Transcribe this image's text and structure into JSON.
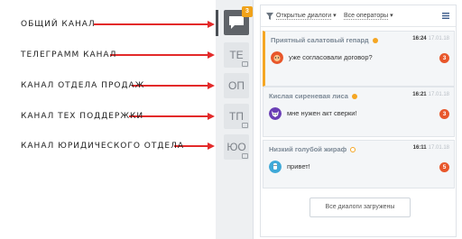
{
  "annotations": [
    {
      "label": "ОБЩИЙ КАНАЛ"
    },
    {
      "label": "ТЕЛЕГРАММ КАНАЛ"
    },
    {
      "label": "КАНАЛ ОТДЕЛА ПРОДАЖ"
    },
    {
      "label": "КАНАЛ ТЕХ ПОДДЕРЖКИ"
    },
    {
      "label": "КАНАЛ ЮРИДИЧЕСКОГО ОТДЕЛА"
    }
  ],
  "channels": {
    "general_badge": "3",
    "items": [
      {
        "label": "ТЕ"
      },
      {
        "label": "ОП"
      },
      {
        "label": "ТП"
      },
      {
        "label": "ЮО"
      }
    ]
  },
  "filters": {
    "dialogs": "Открытые диалоги",
    "operators": "Все операторы"
  },
  "dialogs": [
    {
      "name": "Приятный салатовый гепард",
      "time": "16:24",
      "date": "17.01.18",
      "message": "уже согласовали договор?",
      "count": "3",
      "avatar_color": "#e8572b"
    },
    {
      "name": "Кислая сиреневая лиса",
      "time": "16:21",
      "date": "17.01.18",
      "message": "мне нужен акт сверки!",
      "count": "3",
      "avatar_color": "#6a3fb5"
    },
    {
      "name": "Низкий голубой жираф",
      "time": "16:11",
      "date": "17.01.18",
      "message": "привет!",
      "count": "5",
      "avatar_color": "#3fa9d8"
    }
  ],
  "footer": {
    "loaded_label": "Все диалоги загружены"
  },
  "colors": {
    "accent": "#f5a623",
    "arrow": "#e32a2a",
    "count_badge": "#e8572b"
  }
}
